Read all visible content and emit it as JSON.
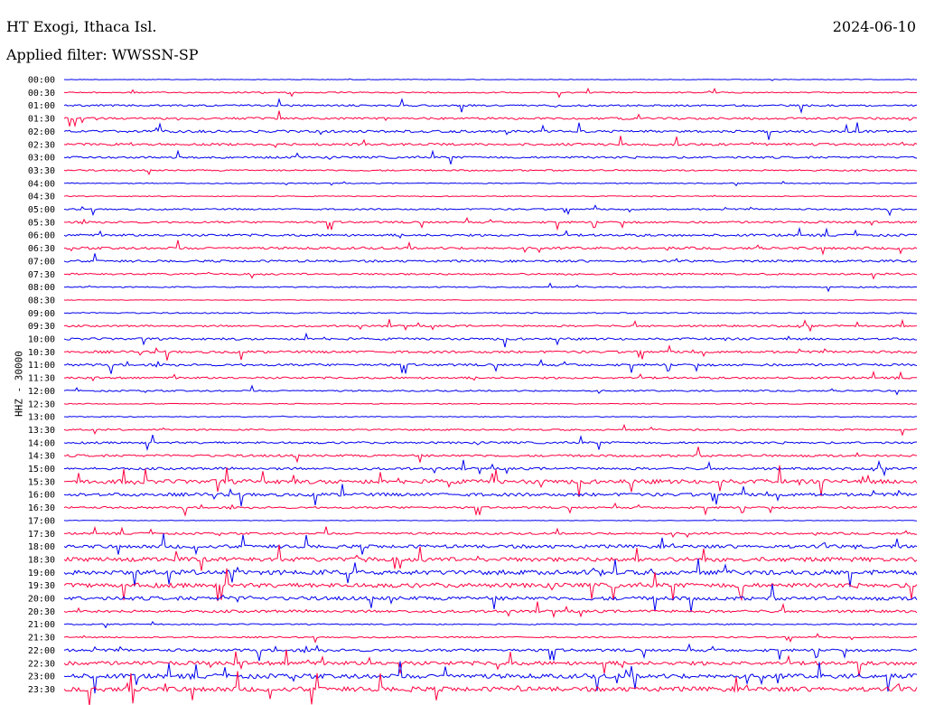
{
  "header": {
    "station": "HT Exogi, Ithaca Isl.",
    "date": "2024-06-10",
    "filter": "Applied filter: WWSSN-SP"
  },
  "chart_data": {
    "type": "line",
    "title": "HT Exogi, Ithaca Isl.",
    "ylabel": "HHZ - 30000",
    "row_labels": [
      "00:00",
      "00:30",
      "01:00",
      "01:30",
      "02:00",
      "02:30",
      "03:00",
      "03:30",
      "04:00",
      "04:30",
      "05:00",
      "05:30",
      "06:00",
      "06:30",
      "07:00",
      "07:30",
      "08:00",
      "08:30",
      "09:00",
      "09:30",
      "10:00",
      "10:30",
      "11:00",
      "11:30",
      "12:00",
      "12:30",
      "13:00",
      "13:30",
      "14:00",
      "14:30",
      "15:00",
      "15:30",
      "16:00",
      "16:30",
      "17:00",
      "17:30",
      "18:00",
      "18:30",
      "19:00",
      "19:30",
      "20:00",
      "20:30",
      "21:00",
      "21:30",
      "22:00",
      "22:30",
      "23:00",
      "23:30"
    ],
    "trace_colors": [
      "#0000ee",
      "#ff0040"
    ],
    "grid": false
  }
}
